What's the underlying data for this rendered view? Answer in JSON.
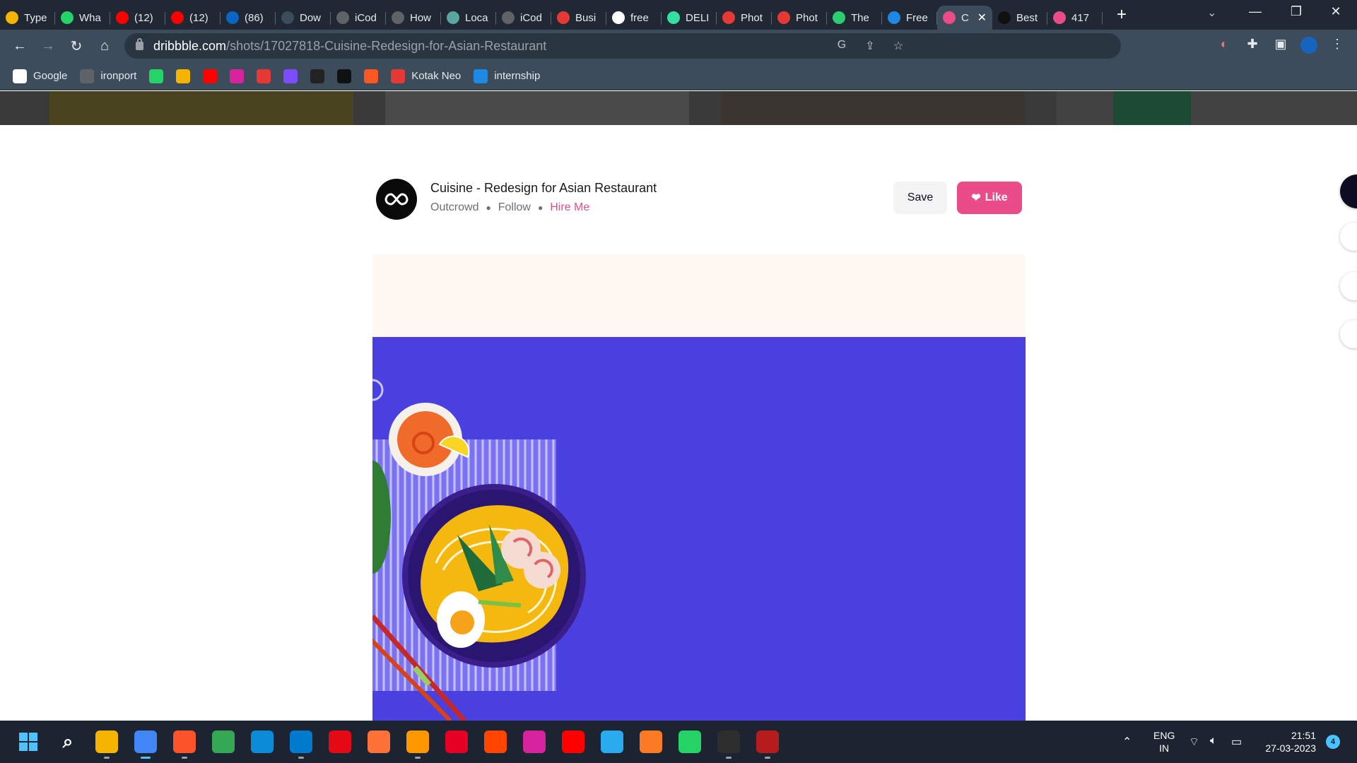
{
  "browser": {
    "tabs": [
      {
        "title": "Type",
        "icon": "sheet-icon",
        "color": "#f4b400"
      },
      {
        "title": "Wha",
        "icon": "whatsapp-icon",
        "color": "#25d366"
      },
      {
        "title": "(12)",
        "icon": "youtube-icon",
        "color": "#ff0000"
      },
      {
        "title": "(12)",
        "icon": "youtube-icon",
        "color": "#ff0000"
      },
      {
        "title": "(86)",
        "icon": "linkedin-icon",
        "color": "#0a66c2"
      },
      {
        "title": "Dow",
        "icon": "download-icon",
        "color": "#3c4c5a"
      },
      {
        "title": "iCod",
        "icon": "globe-icon",
        "color": "#5f6368"
      },
      {
        "title": "How",
        "icon": "globe-icon",
        "color": "#5f6368"
      },
      {
        "title": "Loca",
        "icon": "doc-icon",
        "color": "#5ba6a1"
      },
      {
        "title": "iCod",
        "icon": "globe-icon",
        "color": "#5f6368"
      },
      {
        "title": "Busi",
        "icon": "app-icon",
        "color": "#e53935"
      },
      {
        "title": "free",
        "icon": "google-icon",
        "color": "#ffffff"
      },
      {
        "title": "DELI",
        "icon": "tripadvisor-icon",
        "color": "#34e0a1"
      },
      {
        "title": "Phot",
        "icon": "freepik-icon",
        "color": "#e53935"
      },
      {
        "title": "Phot",
        "icon": "freepik-icon",
        "color": "#e53935"
      },
      {
        "title": "The",
        "icon": "app-icon",
        "color": "#2ecc71"
      },
      {
        "title": "Free",
        "icon": "app-icon",
        "color": "#1e88e5"
      },
      {
        "title": "C",
        "icon": "dribbble-icon",
        "color": "#ea4c89"
      },
      {
        "title": "Best",
        "icon": "app-icon",
        "color": "#111111"
      },
      {
        "title": "417",
        "icon": "dribbble-icon",
        "color": "#ea4c89"
      }
    ],
    "active_tab_index": 17,
    "url_domain": "dribbble.com",
    "url_path": "/shots/17027818-Cuisine-Redesign-for-Asian-Restaurant",
    "bookmarks": [
      {
        "label": "Google",
        "icon": "google-icon",
        "color": "#ffffff"
      },
      {
        "label": "ironport",
        "icon": "globe-icon",
        "color": "#5f6368"
      },
      {
        "label": "",
        "icon": "whatsapp-icon",
        "color": "#25d366"
      },
      {
        "label": "",
        "icon": "classroom-icon",
        "color": "#f4b400"
      },
      {
        "label": "",
        "icon": "youtube-icon",
        "color": "#ff0000"
      },
      {
        "label": "",
        "icon": "instagram-icon",
        "color": "#d6249f"
      },
      {
        "label": "",
        "icon": "app-icon",
        "color": "#e53935"
      },
      {
        "label": "",
        "icon": "bolt-icon",
        "color": "#7c4dff"
      },
      {
        "label": "",
        "icon": "inv-icon",
        "color": "#222222"
      },
      {
        "label": "",
        "icon": "tv-icon",
        "color": "#111111"
      },
      {
        "label": "",
        "icon": "cloud-icon",
        "color": "#ff5722"
      },
      {
        "label": "Kotak Neo",
        "icon": "neo-icon",
        "color": "#e53935"
      },
      {
        "label": "internship",
        "icon": "drive-icon",
        "color": "#1e88e5"
      }
    ]
  },
  "shot": {
    "title": "Cuisine - Redesign for Asian Restaurant",
    "author": "Outcrowd",
    "follow_label": "Follow",
    "hire_label": "Hire Me",
    "save_label": "Save",
    "like_label": "Like",
    "accent_color": "#ea4c89",
    "canvas_color": "#4a40e0"
  },
  "taskbar": {
    "apps": [
      {
        "name": "search-icon",
        "color": "#1c2431"
      },
      {
        "name": "file-explorer-icon",
        "color": "#f4b400"
      },
      {
        "name": "chrome-icon",
        "color": "#4285f4"
      },
      {
        "name": "brave-icon",
        "color": "#fb542b"
      },
      {
        "name": "chrome-icon",
        "color": "#34a853"
      },
      {
        "name": "edge-icon",
        "color": "#0c8bd6"
      },
      {
        "name": "vscode-icon",
        "color": "#007acc"
      },
      {
        "name": "opera-icon",
        "color": "#e50914"
      },
      {
        "name": "firefox-icon",
        "color": "#ff7139"
      },
      {
        "name": "sublime-icon",
        "color": "#ff9800"
      },
      {
        "name": "pinterest-icon",
        "color": "#e60023"
      },
      {
        "name": "reddit-icon",
        "color": "#ff4500"
      },
      {
        "name": "instagram-icon",
        "color": "#d6249f"
      },
      {
        "name": "youtube-icon",
        "color": "#ff0000"
      },
      {
        "name": "telegram-icon",
        "color": "#2aabee"
      },
      {
        "name": "xampp-icon",
        "color": "#fb7a24"
      },
      {
        "name": "whatsapp-icon",
        "color": "#25d366"
      },
      {
        "name": "terminal-icon",
        "color": "#2d2d2d"
      },
      {
        "name": "winrar-icon",
        "color": "#b71c1c"
      }
    ],
    "language": "ENG",
    "region": "IN",
    "time": "21:51",
    "date": "27-03-2023",
    "notifications": "4"
  }
}
